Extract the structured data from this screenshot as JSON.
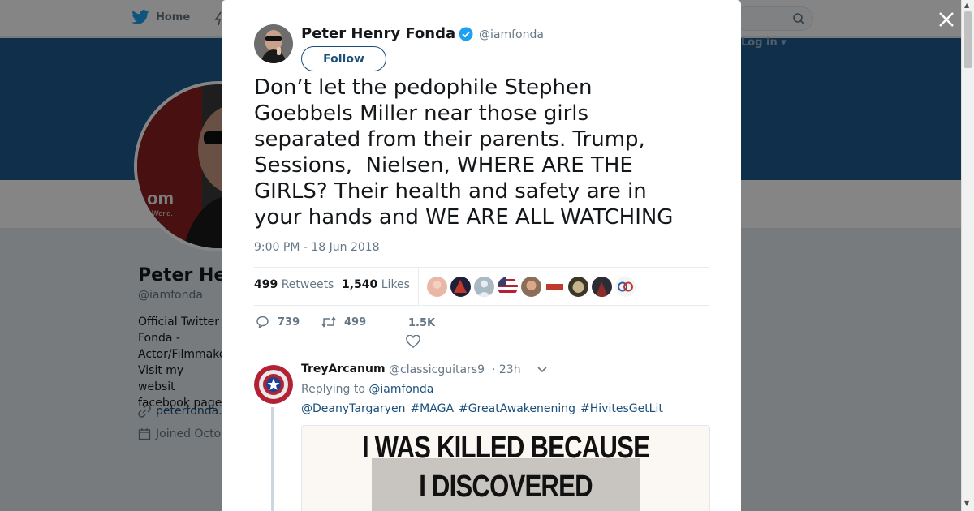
{
  "colors": {
    "link": "#1b4f7a",
    "banner": "#1d5a8f",
    "verified": "#1da1f2"
  },
  "background_page": {
    "nav": {
      "home_label": "Home",
      "home_icon": "twitter-bird-icon",
      "login_label": "Log in ▾"
    },
    "profile": {
      "name": "Peter He",
      "handle": "@iamfonda",
      "bio_lines": [
        "Official Twitter",
        "Fonda -",
        "Actor/Filmmake",
        "Visit my websit",
        "facebook page"
      ],
      "website": "peterfonda.",
      "joined": "Joined Octo"
    }
  },
  "modal": {
    "author": {
      "name": "Peter Henry Fonda",
      "handle": "@iamfonda",
      "verified": true,
      "follow_label": "Follow"
    },
    "tweet": {
      "text": "Don’t let the pedophile Stephen\nGoebbels Miller near those girls\nseparated from their parents. Trump,\nSessions,  Nielsen, WHERE ARE THE\nGIRLS? Their health and safety are in\nyour hands and WE ARE ALL WATCHING",
      "timestamp": "9:00 PM - 18 Jun 2018"
    },
    "stats": {
      "retweets_count": "499",
      "retweets_label": "Retweets",
      "likes_count": "1,540",
      "likes_label": "Likes"
    },
    "actions": {
      "replies": "739",
      "retweets": "499",
      "likes": "1.5K"
    },
    "reply": {
      "name": "TreyArcanum",
      "handle": "@classicguitars9",
      "time": "· 23h",
      "replying_prefix": "Replying to",
      "replying_to": "@iamfonda",
      "hashtags": [
        "@DeanyTargaryen",
        "#MAGA",
        "#GreatAwakenening",
        "#HivitesGetLit"
      ],
      "media_lines": [
        "I WAS KILLED BECAUSE",
        "I DISCOVERED"
      ]
    }
  }
}
